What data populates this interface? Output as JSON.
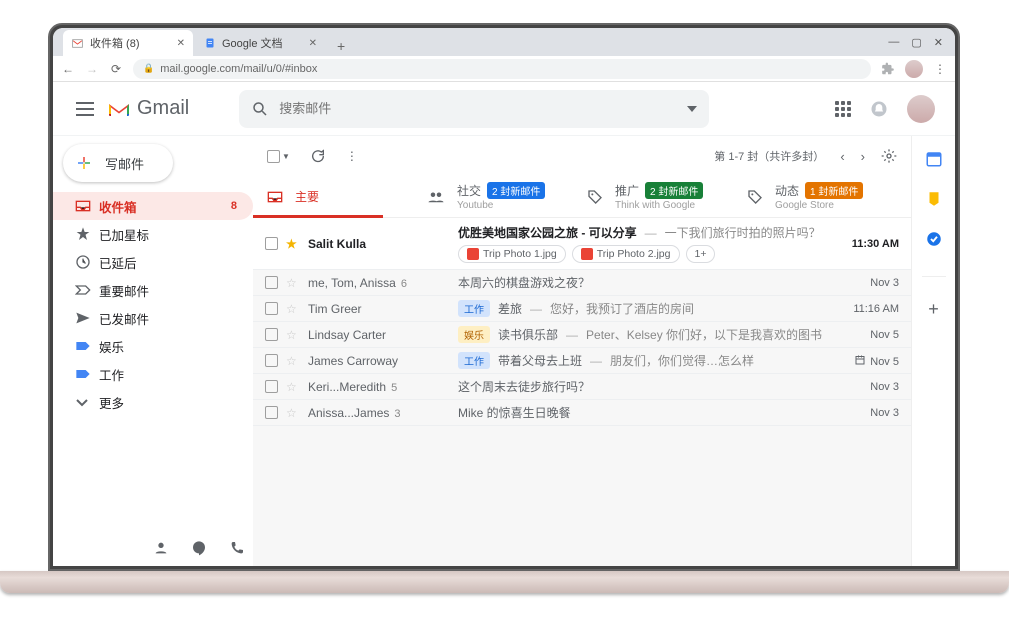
{
  "browser": {
    "tabs": [
      {
        "title": "收件箱 (8)",
        "icon": "gmail"
      },
      {
        "title": "Google 文档",
        "icon": "docs"
      }
    ],
    "url": "mail.google.com/mail/u/0/#inbox"
  },
  "header": {
    "brand": "Gmail",
    "search_placeholder": "搜索邮件"
  },
  "sidebar": {
    "compose": "写邮件",
    "items": [
      {
        "label": "收件箱",
        "count": "8",
        "active": true,
        "icon": "inbox"
      },
      {
        "label": "已加星标",
        "icon": "star"
      },
      {
        "label": "已延后",
        "icon": "clock"
      },
      {
        "label": "重要邮件",
        "icon": "important"
      },
      {
        "label": "已发邮件",
        "icon": "sent"
      },
      {
        "label": "娱乐",
        "icon": "label-blue"
      },
      {
        "label": "工作",
        "icon": "label-blue"
      },
      {
        "label": "更多",
        "icon": "more"
      }
    ]
  },
  "toolbar": {
    "pagination": "第 1-7 封（共许多封）"
  },
  "categories": [
    {
      "label": "主要",
      "icon": "inbox",
      "active": true
    },
    {
      "label": "社交",
      "icon": "people",
      "badge": "2 封新邮件",
      "badge_cls": "b-blue",
      "sub": "Youtube"
    },
    {
      "label": "推广",
      "icon": "tag",
      "badge": "2 封新邮件",
      "badge_cls": "b-green",
      "sub": "Think with Google"
    },
    {
      "label": "动态",
      "icon": "tag",
      "badge": "1 封新邮件",
      "badge_cls": "b-orange",
      "sub": "Google Store"
    }
  ],
  "emails": [
    {
      "sender": "Salit Kulla",
      "starred": true,
      "unread": true,
      "subject": "优胜美地国家公园之旅 - 可以分享",
      "snippet": "一下我们旅行时拍的照片吗？",
      "attachments": [
        "Trip Photo 1.jpg",
        "Trip Photo 2.jpg"
      ],
      "more_attach": "1+",
      "time": "11:30 AM"
    },
    {
      "sender": "me, Tom, Anissa",
      "thread": "6",
      "subject": "本周六的棋盘游戏之夜？",
      "time": "Nov 3"
    },
    {
      "sender": "Tim Greer",
      "label": "工作",
      "label_cls": "lc-blue",
      "subject": "差旅",
      "snippet": "您好，我预订了酒店的房间",
      "time": "11:16 AM"
    },
    {
      "sender": "Lindsay Carter",
      "label": "娱乐",
      "label_cls": "lc-orange",
      "subject": "读书俱乐部",
      "snippet": "Peter、Kelsey 你们好，以下是我喜欢的图书",
      "time": "Nov 5"
    },
    {
      "sender": "James Carroway",
      "label": "工作",
      "label_cls": "lc-blue",
      "subject": "带着父母去上班",
      "snippet": "朋友们，你们觉得…怎么样",
      "time": "Nov 5",
      "scheduled": true
    },
    {
      "sender": "Keri...Meredith",
      "thread": "5",
      "subject": "这个周末去徒步旅行吗？",
      "time": "Nov 3"
    },
    {
      "sender": "Anissa...James",
      "thread": "3",
      "subject": "Mike 的惊喜生日晚餐",
      "time": "Nov 3"
    }
  ]
}
